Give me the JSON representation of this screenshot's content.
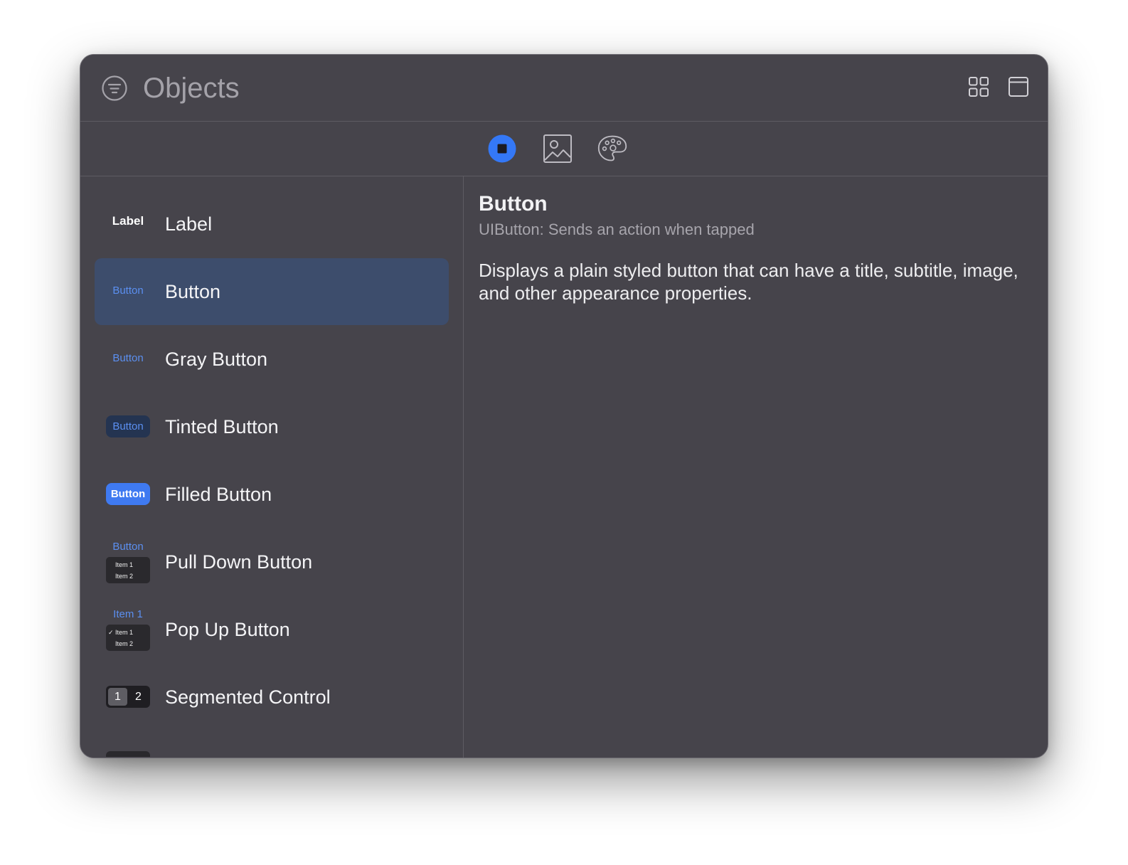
{
  "header": {
    "title": "Objects",
    "icons": [
      "filter-icon",
      "grid-view-icon",
      "window-icon"
    ]
  },
  "library_tabs": [
    {
      "name": "objects",
      "icon": "square-stop-icon",
      "selected": true
    },
    {
      "name": "media",
      "icon": "photo-icon",
      "selected": false
    },
    {
      "name": "colors",
      "icon": "palette-icon",
      "selected": false
    }
  ],
  "colors": {
    "accent": "#3478f6",
    "selection": "#3d4d6c",
    "window_bg": "#46444b"
  },
  "items": [
    {
      "name": "Label",
      "thumb": "Label"
    },
    {
      "name": "Button",
      "thumb": "Button",
      "selected": true
    },
    {
      "name": "Gray Button",
      "thumb": "Button"
    },
    {
      "name": "Tinted Button",
      "thumb": "Button"
    },
    {
      "name": "Filled Button",
      "thumb": "Button"
    },
    {
      "name": "Pull Down Button",
      "thumb": "Button",
      "menu": [
        "Item 1",
        "Item 2"
      ]
    },
    {
      "name": "Pop Up Button",
      "thumb": "Item 1",
      "menu": [
        "✓ Item 1",
        "Item 2"
      ]
    },
    {
      "name": "Segmented Control",
      "segments": [
        "1",
        "2"
      ]
    }
  ],
  "detail": {
    "title": "Button",
    "subtitle": "UIButton: Sends an action when tapped",
    "description": "Displays a plain styled button that can have a title, subtitle, image, and other appearance properties."
  }
}
